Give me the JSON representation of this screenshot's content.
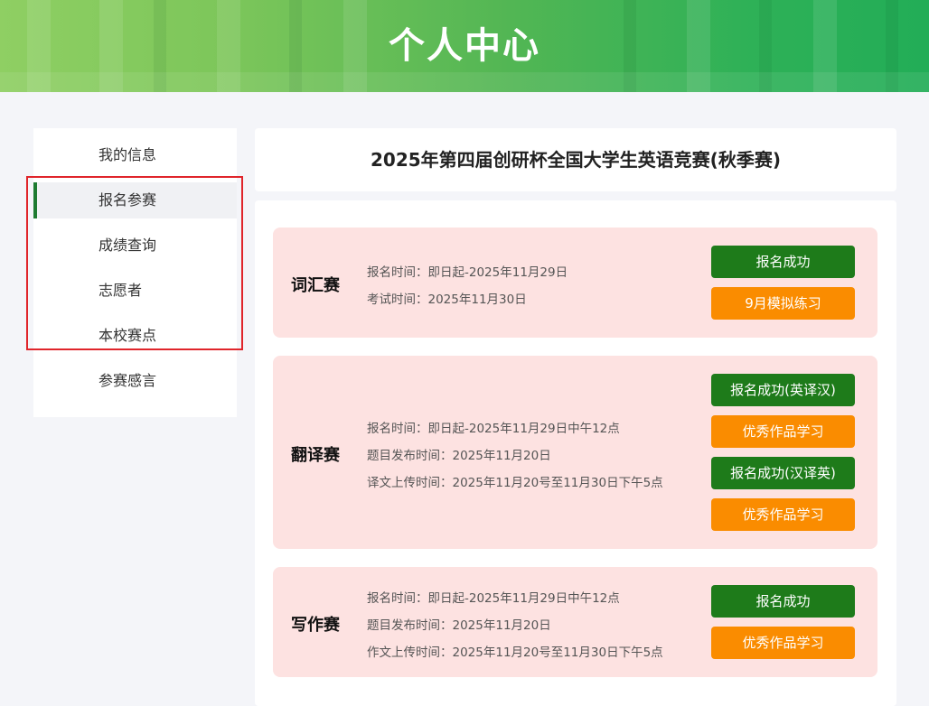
{
  "header": {
    "title": "个人中心"
  },
  "sidebar": {
    "items": [
      {
        "label": "我的信息"
      },
      {
        "label": "报名参赛",
        "active": true
      },
      {
        "label": "成绩查询"
      },
      {
        "label": "志愿者"
      },
      {
        "label": "本校赛点"
      },
      {
        "label": "参赛感言"
      }
    ]
  },
  "contest": {
    "title": "2025年第四届创研杯全国大学生英语竞赛(秋季赛)"
  },
  "competitions": [
    {
      "name": "词汇赛",
      "info": [
        "报名时间：即日起-2025年11月29日",
        "考试时间：2025年11月30日"
      ],
      "buttons": [
        {
          "label": "报名成功",
          "color": "#1e7b1a"
        },
        {
          "label": "9月模拟练习",
          "color": "#fa8c00"
        }
      ]
    },
    {
      "name": "翻译赛",
      "info": [
        "报名时间：即日起-2025年11月29日中午12点",
        "题目发布时间：2025年11月20日",
        "译文上传时间：2025年11月20号至11月30日下午5点"
      ],
      "buttons": [
        {
          "label": "报名成功(英译汉)",
          "color": "#1e7b1a"
        },
        {
          "label": "优秀作品学习",
          "color": "#fa8c00"
        },
        {
          "label": "报名成功(汉译英)",
          "color": "#1e7b1a"
        },
        {
          "label": "优秀作品学习",
          "color": "#fa8c00"
        }
      ]
    },
    {
      "name": "写作赛",
      "info": [
        "报名时间：即日起-2025年11月29日中午12点",
        "题目发布时间：2025年11月20日",
        "作文上传时间：2025年11月20号至11月30日下午5点"
      ],
      "buttons": [
        {
          "label": "报名成功",
          "color": "#1e7b1a"
        },
        {
          "label": "优秀作品学习",
          "color": "#fa8c00"
        }
      ]
    }
  ]
}
